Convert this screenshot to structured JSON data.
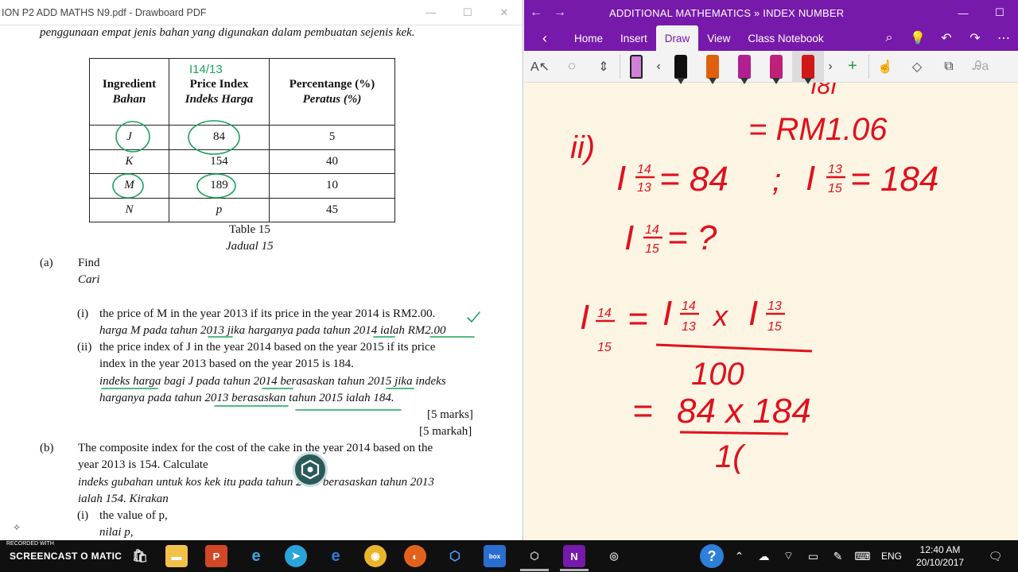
{
  "pdf": {
    "title": "ION P2 ADD MATHS N9.pdf - Drawboard PDF",
    "intro_line": "penggunaan empat jenis bahan yang digunakan dalam pembuatan sejenis kek.",
    "table": {
      "headers": [
        {
          "en": "Ingredient",
          "ms": "Bahan"
        },
        {
          "en": "Price Index",
          "ms": "Indeks Harga"
        },
        {
          "en": "Percentange (%)",
          "ms": "Peratus (%)"
        }
      ],
      "rows": [
        [
          "J",
          "84",
          "5"
        ],
        [
          "K",
          "154",
          "40"
        ],
        [
          "M",
          "189",
          "10"
        ],
        [
          "N",
          "p",
          "45"
        ]
      ],
      "caption_en": "Table 15",
      "caption_ms": "Jadual 15"
    },
    "q_a_label": "(a)",
    "q_a_find": "Find",
    "q_a_cari": "Cari",
    "q_a_i_label": "(i)",
    "q_a_i_en": "the price of M in the year 2013 if its price in the year 2014 is RM2.00.",
    "q_a_i_ms": "harga M pada tahun 2013 jika harganya pada tahun 2014 ialah RM2.00",
    "q_a_ii_label": "(ii)",
    "q_a_ii_en1": "the price index of J in the year 2014 based on the year 2015 if its price",
    "q_a_ii_en2": "index in the year 2013 based on the year 2015 is 184.",
    "q_a_ii_ms1": "indeks harga bagi J pada tahun 2014 berasaskan tahun 2015 jika indeks",
    "q_a_ii_ms2": "harganya pada tahun 2013 berasaskan tahun 2015 ialah 184.",
    "marks_en": "[5 marks]",
    "marks_ms": "[5 markah]",
    "q_b_label": "(b)",
    "q_b_en1": "The composite index for the cost of the cake in the year 2014 based on the",
    "q_b_en2": "year 2013 is 154. Calculate",
    "q_b_ms1": "indeks gubahan untuk kos kek itu pada tahun 2014 berasaskan tahun 2013",
    "q_b_ms2": "ialah 154. Kirakan",
    "q_b_i_label": "(i)",
    "q_b_i_en": "the value of p,",
    "q_b_i_ms": "nilai p,",
    "annot_table_header": "I14/13"
  },
  "onenote": {
    "title": "ADDITIONAL MATHEMATICS » INDEX NUMBER",
    "tabs": [
      "Home",
      "Insert",
      "Draw",
      "View",
      "Class Notebook"
    ],
    "active_tab": "Draw",
    "ink": {
      "top_result": "= RM1.06",
      "part_label": "ii)",
      "given_1": "I 14/13 = 84",
      "given_2": "I 13/15 = 184",
      "sep": ";",
      "unknown": "I 14/15 = ?",
      "formula_lhs": "I 14/15",
      "formula_rhs_num": "I 14/13 x I 13/15",
      "formula_den": "100",
      "calc_num": "84 x 184",
      "calc_den_partial": "1("
    },
    "pen_colors": [
      "#111111",
      "#e06010",
      "#b02090",
      "#c0207a",
      "#d01818"
    ]
  },
  "taskbar": {
    "recorded_with": "RECORDED WITH",
    "brand": "SCREENCAST O MATIC",
    "language": "ENG",
    "time": "12:40 AM",
    "date": "20/10/2017"
  }
}
